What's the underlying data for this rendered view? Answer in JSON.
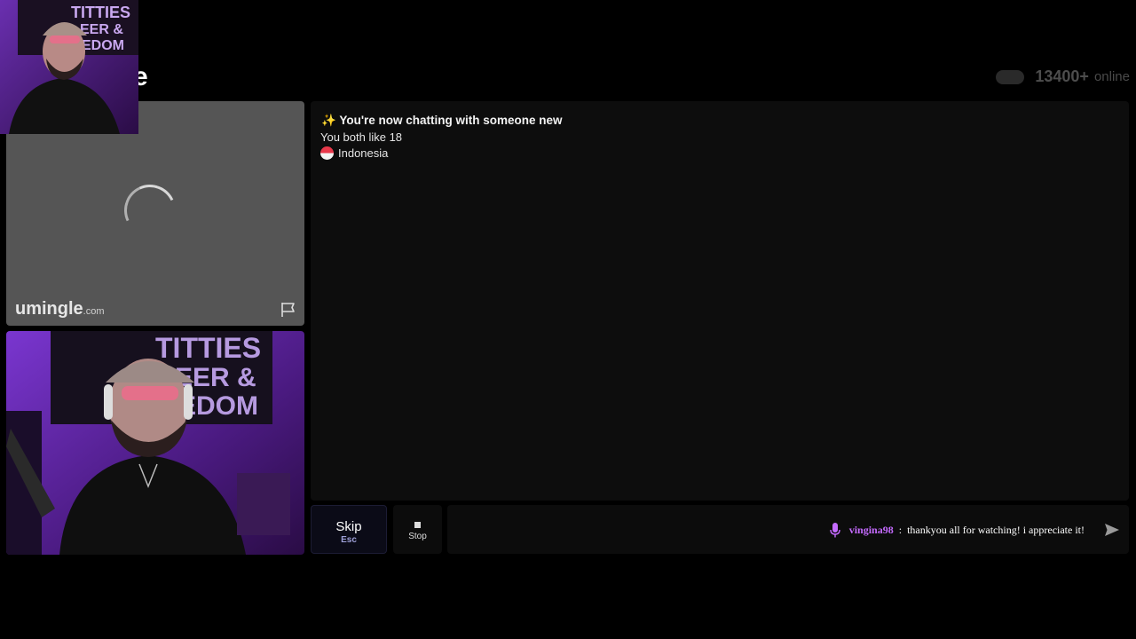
{
  "header": {
    "logo_partial": "e",
    "online_count": "13400+",
    "online_label": "online"
  },
  "stranger_video": {
    "brand_name": "umingle",
    "brand_suffix": ".com"
  },
  "chat": {
    "title": "You're now chatting with someone new",
    "title_icon": "sparkles-icon",
    "shared_interest": "You both like 18",
    "country": "Indonesia"
  },
  "controls": {
    "skip_label": "Skip",
    "skip_key": "Esc",
    "stop_label": "Stop"
  },
  "overlay_message": {
    "username": "vingina98",
    "separator": ":",
    "text": "thankyou all for watching! i appreciate it!"
  },
  "colors": {
    "background": "#000000",
    "panel": "#0d0d0d",
    "accent_username": "#c56bff",
    "video_placeholder": "#555555"
  }
}
